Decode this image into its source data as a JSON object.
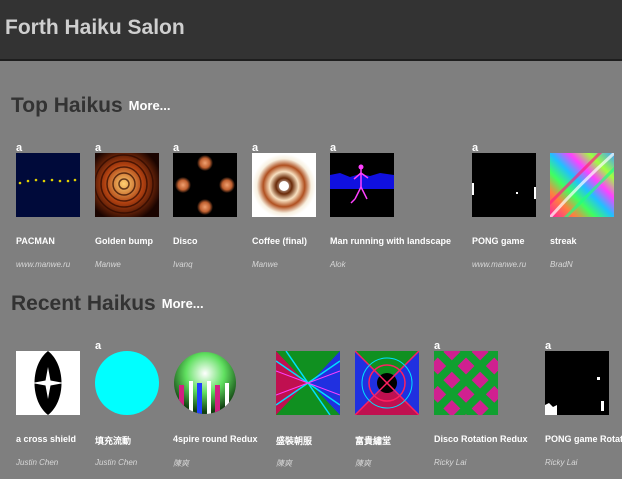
{
  "header": {
    "title": "Forth Haiku Salon"
  },
  "top": {
    "title": "Top Haikus",
    "more": "More...",
    "items": [
      {
        "marker": "a",
        "name": "PACMAN",
        "author": "www.manwe.ru",
        "thumb": "pacman"
      },
      {
        "marker": "a",
        "name": "Golden bump",
        "author": "Manwe",
        "thumb": "golden-bump"
      },
      {
        "marker": "a",
        "name": "Disco",
        "author": "Ivanq",
        "thumb": "disco"
      },
      {
        "marker": "a",
        "name": "Coffee (final)",
        "author": "Manwe",
        "thumb": "coffee"
      },
      {
        "marker": "a",
        "name": "Man running with landscape",
        "author": "Alok",
        "thumb": "man-running"
      },
      {
        "marker": "a",
        "name": "PONG game",
        "author": "www.manwe.ru",
        "thumb": "pong"
      },
      {
        "marker": "",
        "name": "streak",
        "author": "BradN",
        "thumb": "streak"
      }
    ]
  },
  "recent": {
    "title": "Recent Haikus",
    "more": "More...",
    "items": [
      {
        "marker": "",
        "name": "a cross shield",
        "author": "Justin Chen",
        "thumb": "cross-shield"
      },
      {
        "marker": "a",
        "name": "填充流動",
        "author": "Justin Chen",
        "thumb": "cyan-disc"
      },
      {
        "marker": "",
        "name": "4spire round Redux",
        "author": "陳爽",
        "thumb": "spire"
      },
      {
        "marker": "",
        "name": "盛裝朝服",
        "author": "陳爽",
        "thumb": "pattern-a"
      },
      {
        "marker": "",
        "name": "富貴繡堂",
        "author": "陳爽",
        "thumb": "pattern-b"
      },
      {
        "marker": "a",
        "name": "Disco Rotation Redux",
        "author": "Ricky Lai",
        "thumb": "disco-rotation"
      },
      {
        "marker": "a",
        "name": "PONG game Rotation",
        "author": "Ricky Lai",
        "thumb": "pong-rotation"
      }
    ]
  }
}
